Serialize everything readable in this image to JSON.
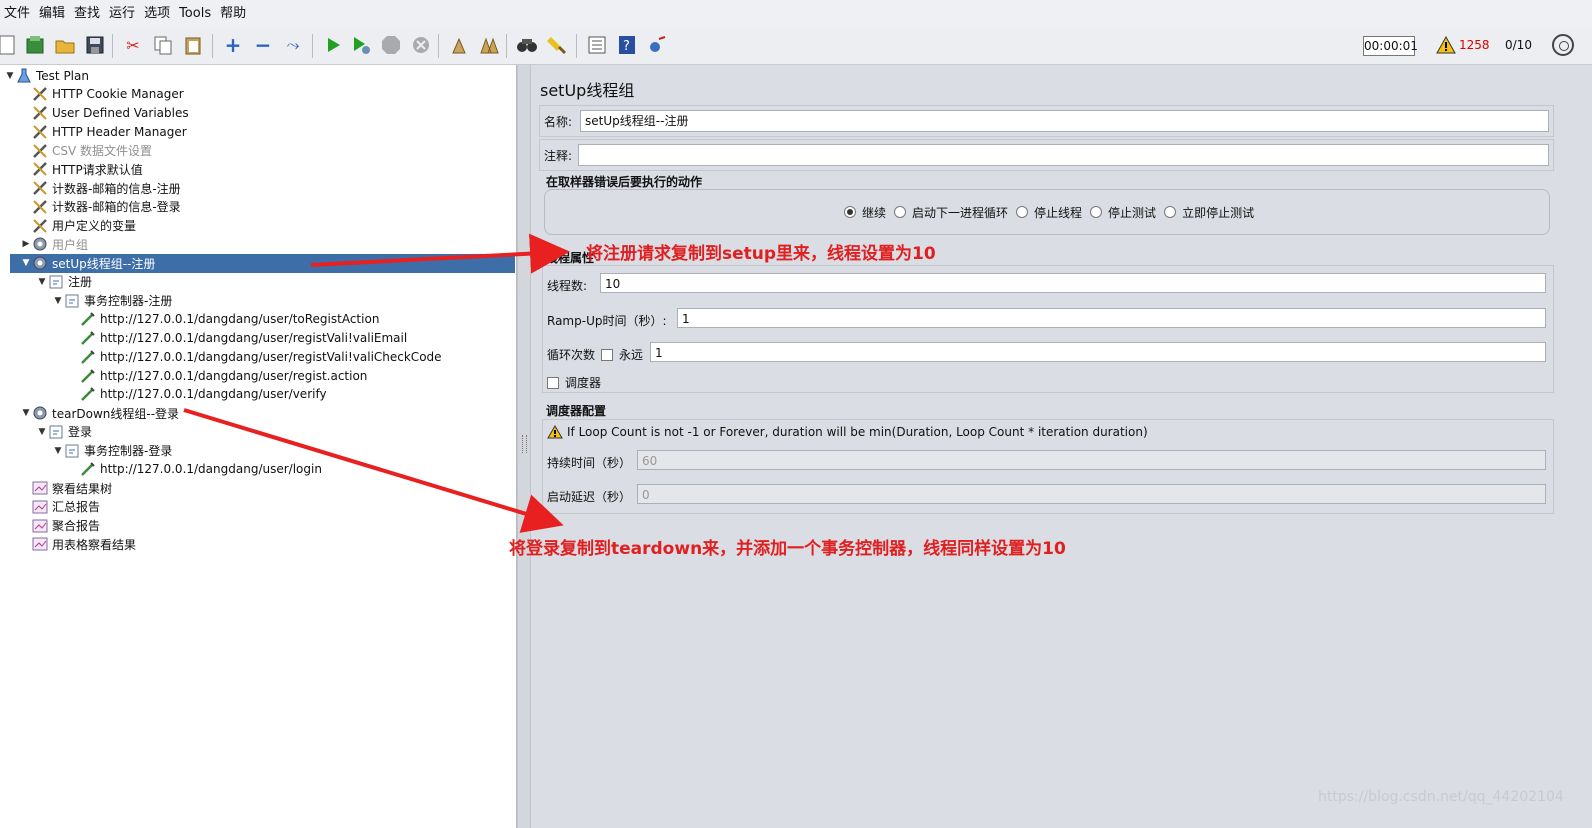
{
  "menu": [
    "文件",
    "编辑",
    "查找",
    "运行",
    "选项",
    "Tools",
    "帮助"
  ],
  "status": {
    "timer": "00:00:01",
    "error_count": "1258",
    "threads": "0/10"
  },
  "tree": [
    {
      "label": "Test Plan",
      "indent": 0,
      "arrow": "▼",
      "icon": "flask-icon",
      "state": ""
    },
    {
      "label": "HTTP Cookie Manager",
      "indent": 1,
      "arrow": "",
      "icon": "wrench-icon",
      "state": ""
    },
    {
      "label": "User Defined Variables",
      "indent": 1,
      "arrow": "",
      "icon": "wrench-icon",
      "state": ""
    },
    {
      "label": "HTTP Header Manager",
      "indent": 1,
      "arrow": "",
      "icon": "wrench-icon",
      "state": ""
    },
    {
      "label": "CSV 数据文件设置",
      "indent": 1,
      "arrow": "",
      "icon": "wrench-icon",
      "state": "disabled"
    },
    {
      "label": "HTTP请求默认值",
      "indent": 1,
      "arrow": "",
      "icon": "wrench-icon",
      "state": ""
    },
    {
      "label": "计数器-邮箱的信息-注册",
      "indent": 1,
      "arrow": "",
      "icon": "wrench-icon",
      "state": ""
    },
    {
      "label": "计数器-邮箱的信息-登录",
      "indent": 1,
      "arrow": "",
      "icon": "wrench-icon",
      "state": ""
    },
    {
      "label": "用户定义的变量",
      "indent": 1,
      "arrow": "",
      "icon": "wrench-icon",
      "state": ""
    },
    {
      "label": "用户组",
      "indent": 1,
      "arrow": "▶",
      "icon": "gear-icon",
      "state": "disabled"
    },
    {
      "label": "setUp线程组--注册",
      "indent": 1,
      "arrow": "▼",
      "icon": "gear-icon",
      "state": "selected"
    },
    {
      "label": "注册",
      "indent": 2,
      "arrow": "▼",
      "icon": "controller-icon",
      "state": ""
    },
    {
      "label": "事务控制器-注册",
      "indent": 3,
      "arrow": "▼",
      "icon": "controller-icon",
      "state": ""
    },
    {
      "label": "http://127.0.0.1/dangdang/user/toRegistAction",
      "indent": 4,
      "arrow": "",
      "icon": "pipette-icon",
      "state": ""
    },
    {
      "label": "http://127.0.0.1/dangdang/user/registVali!valiEmail",
      "indent": 4,
      "arrow": "",
      "icon": "pipette-icon",
      "state": ""
    },
    {
      "label": "http://127.0.0.1/dangdang/user/registVali!valiCheckCode",
      "indent": 4,
      "arrow": "",
      "icon": "pipette-icon",
      "state": ""
    },
    {
      "label": "http://127.0.0.1/dangdang/user/regist.action",
      "indent": 4,
      "arrow": "",
      "icon": "pipette-icon",
      "state": ""
    },
    {
      "label": "http://127.0.0.1/dangdang/user/verify",
      "indent": 4,
      "arrow": "",
      "icon": "pipette-icon",
      "state": ""
    },
    {
      "label": "tearDown线程组--登录",
      "indent": 1,
      "arrow": "▼",
      "icon": "gear-icon",
      "state": ""
    },
    {
      "label": "登录",
      "indent": 2,
      "arrow": "▼",
      "icon": "controller-icon",
      "state": ""
    },
    {
      "label": "事务控制器-登录",
      "indent": 3,
      "arrow": "▼",
      "icon": "controller-icon",
      "state": ""
    },
    {
      "label": "http://127.0.0.1/dangdang/user/login",
      "indent": 4,
      "arrow": "",
      "icon": "pipette-icon",
      "state": ""
    },
    {
      "label": "察看结果树",
      "indent": 1,
      "arrow": "",
      "icon": "chart-icon",
      "state": ""
    },
    {
      "label": "汇总报告",
      "indent": 1,
      "arrow": "",
      "icon": "chart-icon",
      "state": ""
    },
    {
      "label": "聚合报告",
      "indent": 1,
      "arrow": "",
      "icon": "chart-icon",
      "state": ""
    },
    {
      "label": "用表格察看结果",
      "indent": 1,
      "arrow": "",
      "icon": "chart-icon",
      "state": ""
    }
  ],
  "panel": {
    "title": "setUp线程组",
    "name_label": "名称:",
    "name_value": "setUp线程组--注册",
    "comment_label": "注释:",
    "comment_value": "",
    "error_action_title": "在取样器错误后要执行的动作",
    "error_actions": [
      "继续",
      "启动下一进程循环",
      "停止线程",
      "停止测试",
      "立即停止测试"
    ],
    "thread_props_title": "线程属性",
    "threads_label": "线程数:",
    "threads_value": "10",
    "rampup_label": "Ramp-Up时间（秒）:",
    "rampup_value": "1",
    "loop_label": "循环次数",
    "forever_label": "永远",
    "loop_value": "1",
    "scheduler_label": "调度器",
    "scheduler_config_title": "调度器配置",
    "scheduler_warning": "If Loop Count is not -1 or Forever, duration will be min(Duration, Loop Count * iteration duration)",
    "duration_label": "持续时间（秒）",
    "duration_value": "60",
    "delay_label": "启动延迟（秒）",
    "delay_value": "0"
  },
  "annotations": {
    "setup_note": "将注册请求复制到setup里来，线程设置为10",
    "teardown_note": "将登录复制到teardown来，并添加一个事务控制器，线程同样设置为10"
  },
  "watermark": "https://blog.csdn.net/qq_44202104",
  "colors": {
    "selected": "#3d6ea8",
    "annotation": "#e02020",
    "panel_bg": "#dadde3"
  }
}
